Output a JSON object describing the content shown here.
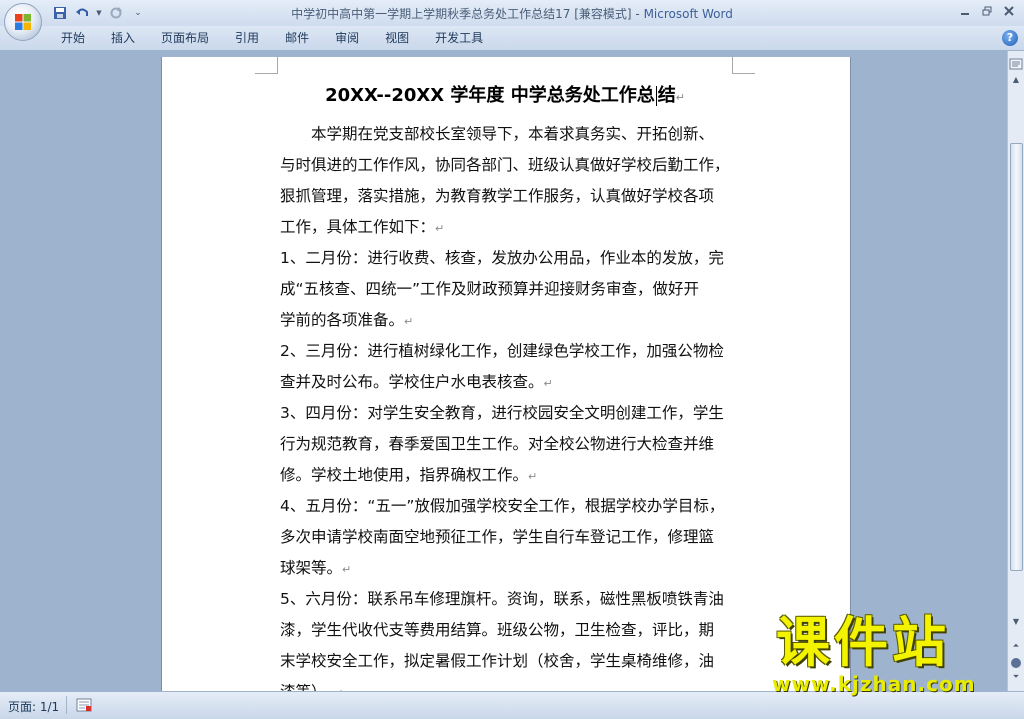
{
  "window": {
    "title": "中学初中高中第一学期上学期秋季总务处工作总结17 [兼容模式] - ",
    "app_name": "Microsoft Word",
    "controls": [
      "minimize",
      "restore",
      "close"
    ]
  },
  "ribbon": {
    "tabs": [
      "开始",
      "插入",
      "页面布局",
      "引用",
      "邮件",
      "审阅",
      "视图",
      "开发工具"
    ]
  },
  "document": {
    "title": "20XX--20XX 学年度  中学总务处工作总",
    "title_after_cursor": "结",
    "paragraphs": [
      {
        "indent": true,
        "lines": [
          "本学期在党支部校长室领导下，本着求真务实、开拓创新、",
          "与时俱进的工作作风，协同各部门、班级认真做好学校后勤工作，",
          "狠抓管理，落实措施，为教育教学工作服务，认真做好学校各项",
          "工作，具体工作如下："
        ]
      },
      {
        "indent": false,
        "lines": [
          "1、二月份：进行收费、核查，发放办公用品，作业本的发放，完",
          "成“五核查、四统一”工作及财政预算并迎接财务审查，做好开",
          "学前的各项准备。"
        ]
      },
      {
        "indent": false,
        "lines": [
          "2、三月份：进行植树绿化工作，创建绿色学校工作，加强公物检",
          "查并及时公布。学校住户水电表核查。"
        ]
      },
      {
        "indent": false,
        "lines": [
          "3、四月份：对学生安全教育，进行校园安全文明创建工作，学生",
          "行为规范教育，春季爱国卫生工作。对全校公物进行大检查并维",
          "修。学校土地使用，指界确权工作。"
        ]
      },
      {
        "indent": false,
        "lines": [
          "4、五月份：“五一”放假加强学校安全工作，根据学校办学目标，",
          "多次申请学校南面空地预征工作，学生自行车登记工作，修理篮",
          "球架等。"
        ]
      },
      {
        "indent": false,
        "lines": [
          "5、六月份：联系吊车修理旗杆。资询，联系，磁性黑板喷铁青油",
          "漆，学生代收代支等费用结算。班级公物，卫生检查，评比，期",
          "末学校安全工作，拟定暑假工作计划（校舍，学生桌椅维修，油",
          "漆等）。"
        ]
      }
    ],
    "paragraph_mark": "↵"
  },
  "statusbar": {
    "page_count": "页面: 1/1"
  },
  "watermark": {
    "text": "课件站",
    "url": "www.kjzhan.com"
  },
  "colors": {
    "workspace": "#9eb3cd",
    "page": "#ffffff",
    "app_name": "#3d5f9a",
    "watermark": "#f3f300"
  }
}
